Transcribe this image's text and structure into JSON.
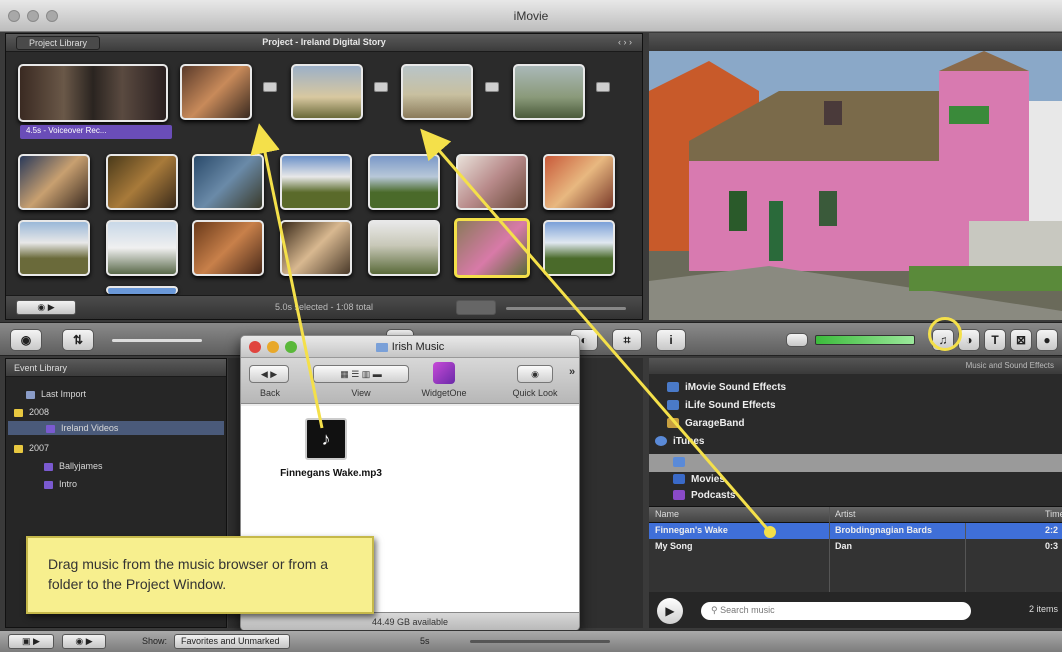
{
  "app": {
    "title": "iMovie"
  },
  "project": {
    "tab_label": "Project Library",
    "title": "Project - Ireland Digital Story",
    "nav_arrows": "‹ › ›",
    "clip_label": "4.5s - Voiceover Rec...",
    "status": "5.0s selected - 1:08 total"
  },
  "event_library": {
    "header": "Event Library",
    "items": [
      {
        "label": "Last Import",
        "color": "#8a9cc8"
      },
      {
        "label": "2008",
        "color": "#e8c840"
      },
      {
        "label": "Ireland Videos",
        "color": "#7a5ad0"
      },
      {
        "label": "2007",
        "color": "#e8c840"
      },
      {
        "label": "Ballyjames",
        "color": "#7a5ad0"
      },
      {
        "label": "Intro",
        "color": "#7a5ad0"
      }
    ]
  },
  "finder": {
    "title": "Irish Music",
    "labels": {
      "back": "Back",
      "view": "View",
      "widget": "WidgetOne",
      "quicklook": "Quick Look"
    },
    "file_name": "Finnegans Wake.mp3",
    "status": "44.49 GB available"
  },
  "music": {
    "header": "Music and Sound Effects",
    "sources": [
      {
        "label": "iMovie Sound Effects"
      },
      {
        "label": "iLife Sound Effects"
      },
      {
        "label": "GarageBand"
      },
      {
        "label": "iTunes"
      },
      {
        "label": ""
      },
      {
        "label": "Movies"
      },
      {
        "label": "Podcasts"
      }
    ],
    "columns": {
      "name": "Name",
      "artist": "Artist",
      "time": "Time"
    },
    "tracks": [
      {
        "name": "Finnegan's Wake",
        "artist": "Brobdingnagian Bards",
        "time": "2:2"
      },
      {
        "name": "My Song",
        "artist": "Dan",
        "time": "0:3"
      }
    ],
    "search_placeholder": "Search music",
    "items_count": "2 items"
  },
  "bottom": {
    "show_label": "Show:",
    "show_value": "Favorites and Unmarked",
    "zoom_label": "5s"
  },
  "callout": {
    "text": "Drag music from the music browser or from a folder to the Project Window."
  },
  "colors": {
    "highlight": "#f4e04a",
    "callout_bg": "#f7ef8e",
    "selection": "#3f6fd8",
    "event_purple": "#7a5ad0"
  }
}
